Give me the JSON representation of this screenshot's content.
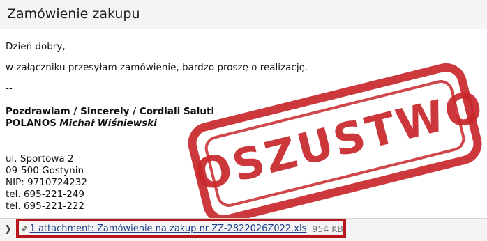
{
  "header": {
    "subject": "Zamówienie zakupu"
  },
  "message": {
    "greeting": "Dzień dobry,",
    "body": "w załączniku przesyłam zamówienie, bardzo proszę o realizację.",
    "separator": "--",
    "signature_line1": "Pozdrawiam / Sincerely / Cordiali Saluti",
    "company": "POLANOS",
    "person": "Michał Wiśniewski",
    "address": [
      "ul. Sportowa 2",
      "09-500 Gostynin",
      "NIP: 9710724232",
      "tel. 695-221-249",
      "tel. 695-221-222"
    ]
  },
  "stamp": {
    "text": "OSZUSTWO",
    "color": "#c8272b"
  },
  "attachments": {
    "label": "1 attachment: Zamówienie na zakup nr ZZ-2822026Z022.xls",
    "size": "954 KB",
    "highlight_color": "#b5151b",
    "icon": "paperclip-icon",
    "toggle_icon": "chevron-right-icon"
  }
}
